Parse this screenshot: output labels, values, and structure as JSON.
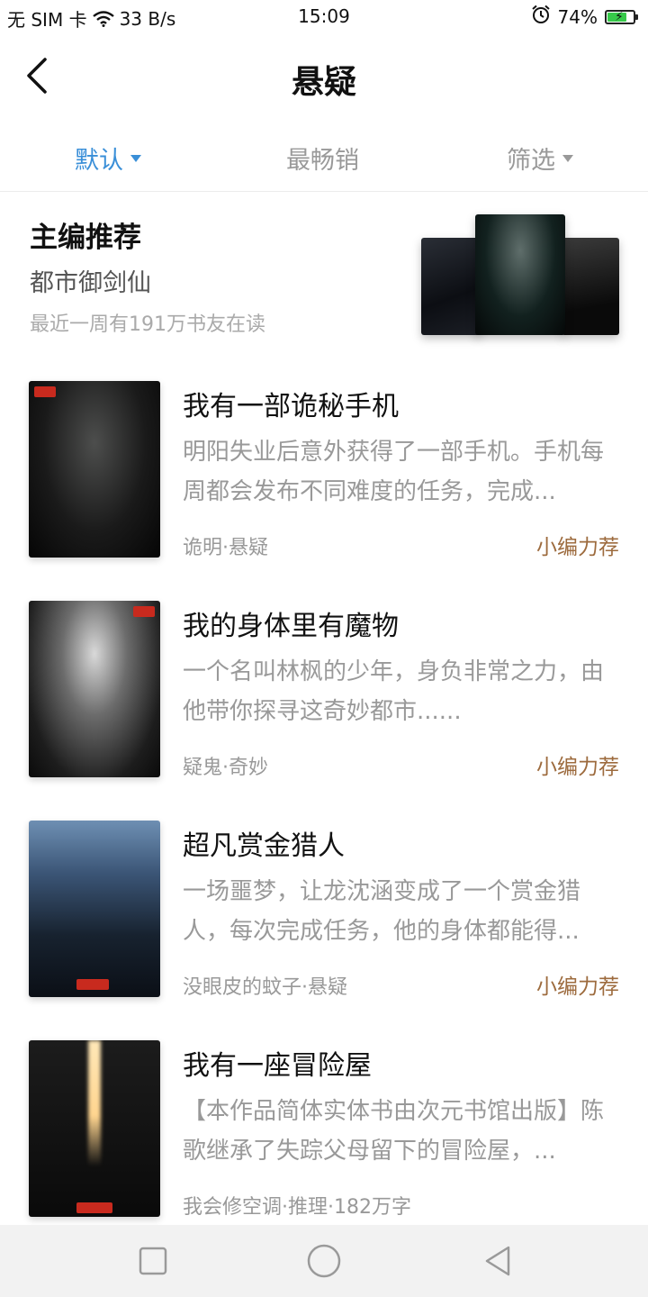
{
  "status_bar": {
    "carrier": "无 SIM 卡",
    "speed": "33 B/s",
    "time": "15:09",
    "battery": "74%",
    "battery_fill": 0.74,
    "wifi_icon": "wifi-icon",
    "alarm_icon": "alarm-icon"
  },
  "header": {
    "title": "悬疑",
    "back_icon": "chevron-left-icon"
  },
  "tabs": [
    {
      "label": "默认",
      "active": true,
      "dropdown": true
    },
    {
      "label": "最畅销",
      "active": false,
      "dropdown": false
    },
    {
      "label": "筛选",
      "active": false,
      "dropdown": true
    }
  ],
  "editor_pick": {
    "heading": "主编推荐",
    "book": "都市御剑仙",
    "readers": "最近一周有191万书友在读"
  },
  "books": [
    {
      "title": "我有一部诡秘手机",
      "desc": "明阳失业后意外获得了一部手机。手机每周都会发布不同难度的任务，完成...",
      "meta": "诡明·悬疑",
      "tag": "小编力荐"
    },
    {
      "title": "我的身体里有魔物",
      "desc": "一个名叫林枫的少年，身负非常之力，由他带你探寻这奇妙都市......",
      "meta": "疑鬼·奇妙",
      "tag": "小编力荐"
    },
    {
      "title": "超凡赏金猎人",
      "desc": "一场噩梦，让龙沈涵变成了一个赏金猎人，每次完成任务，他的身体都能得...",
      "meta": "没眼皮的蚊子·悬疑",
      "tag": "小编力荐"
    },
    {
      "title": "我有一座冒险屋",
      "desc": "【本作品简体实体书由次元书馆出版】陈歌继承了失踪父母留下的冒险屋，...",
      "meta": "我会修空调·推理·182万字",
      "tag": ""
    }
  ],
  "nav_bar": {
    "recent_icon": "square-icon",
    "home_icon": "circle-icon",
    "back_icon": "triangle-back-icon"
  },
  "colors": {
    "accent": "#3a8fd8",
    "tag": "#9d6b3e",
    "muted": "#999999"
  }
}
